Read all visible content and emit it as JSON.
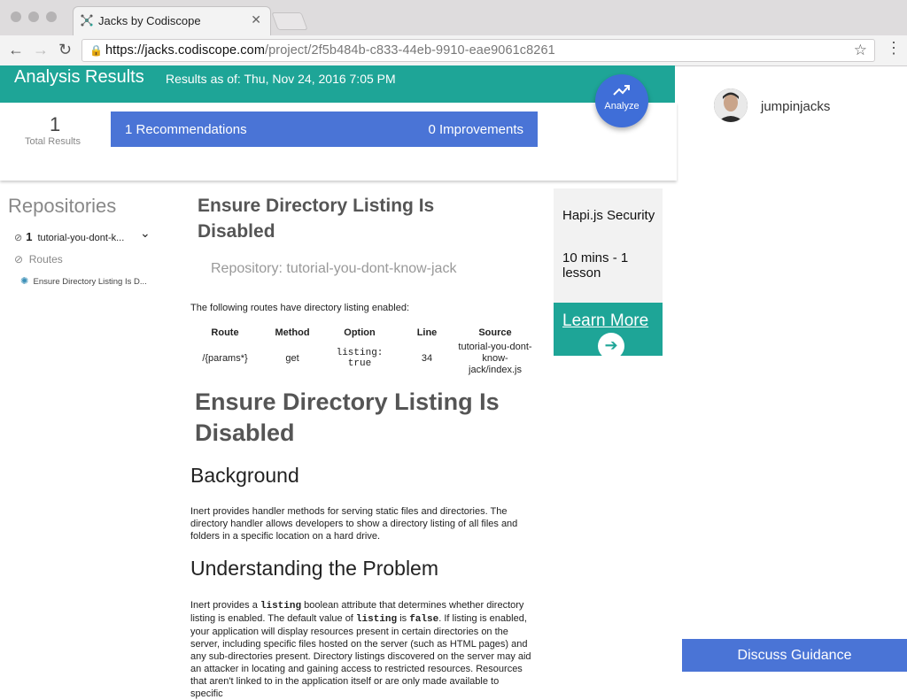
{
  "browser": {
    "tab_title": "Jacks by Codiscope",
    "url_host": "https://jacks.codiscope.com",
    "url_path": "/project/2f5b484b-c833-44eb-9910-eae9061c8261"
  },
  "header": {
    "title": "Analysis Results",
    "results_as_of": "Results as of: Thu, Nov 24, 2016 7:05 PM",
    "analyze_label": "Analyze"
  },
  "summary": {
    "total": "1",
    "total_label": "Total Results",
    "recommendations": "1 Recommendations",
    "improvements": "0 Improvements"
  },
  "user": {
    "name": "jumpinjacks"
  },
  "sidebar": {
    "title": "Repositories",
    "repo_count": "1",
    "repo_name": "tutorial-you-dont-k...",
    "routes_label": "Routes",
    "route_item": "Ensure Directory Listing Is D..."
  },
  "main": {
    "title": "Ensure Directory Listing Is Disabled",
    "repository": "Repository: tutorial-you-dont-know-jack",
    "intro": "The following routes have directory listing enabled:",
    "table": {
      "headers": [
        "Route",
        "Method",
        "Option",
        "Line",
        "Source"
      ],
      "row": {
        "route": "/{params*}",
        "method": "get",
        "option_a": "listing:",
        "option_b": "true",
        "line": "34",
        "source": "tutorial-you-dont-know-jack/index.js"
      }
    },
    "guidance_title": "Ensure Directory Listing Is Disabled",
    "background_heading": "Background",
    "background_text": "Inert provides handler methods for serving static files and directories. The directory handler allows developers to show a directory listing of all files and folders in a specific location on a hard drive.",
    "problem_heading": "Understanding the Problem",
    "problem_text_1": "Inert provides a ",
    "problem_code_1": "listing",
    "problem_text_2": " boolean attribute that determines whether directory listing is enabled. The default value of ",
    "problem_code_2": "listing",
    "problem_text_3": " is ",
    "problem_code_3": "false",
    "problem_text_4": ". If listing is enabled, your application will display resources present in certain directories on the server, including specific files hosted on the server (such as HTML pages) and any sub-directories present. Directory listings discovered on the server may aid an attacker in locating and gaining access to restricted resources. Resources that aren't linked to in the application itself or are only made available to specific"
  },
  "course": {
    "title": "Hapi.js Security",
    "duration": "10 mins - 1 lesson",
    "cta": "Learn More"
  },
  "discuss_label": "Discuss Guidance",
  "colors": {
    "teal": "#1ea597",
    "blue": "#4a74d6"
  }
}
